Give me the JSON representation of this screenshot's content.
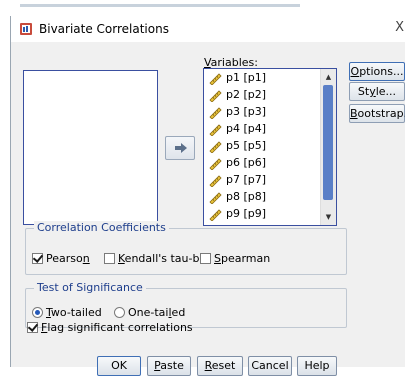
{
  "window": {
    "title": "Bivariate Correlations",
    "close_glyph": "X"
  },
  "variables": {
    "label": "Variables:",
    "items": [
      "p1 [p1]",
      "p2 [p2]",
      "p3 [p3]",
      "p4 [p4]",
      "p5 [p5]",
      "p6 [p6]",
      "p7 [p7]",
      "p8 [p8]",
      "p9 [p9]"
    ]
  },
  "side_buttons": {
    "options": "Options...",
    "style": "Style...",
    "bootstrap": "Bootstrap..."
  },
  "correlation_coefficients": {
    "title": "Correlation Coefficients",
    "pearson": {
      "label": "Pearson",
      "checked": true
    },
    "kendall": {
      "label": "Kendall's tau-b",
      "checked": false
    },
    "spearman": {
      "label": "Spearman",
      "checked": false
    }
  },
  "significance": {
    "title": "Test of Significance",
    "two_tailed": {
      "label": "Two-tailed",
      "selected": true
    },
    "one_tailed": {
      "label": "One-tailed",
      "selected": false
    }
  },
  "flag": {
    "label": "Flag significant correlations",
    "checked": true
  },
  "buttons": {
    "ok": "OK",
    "paste": "Paste",
    "reset": "Reset",
    "cancel": "Cancel",
    "help": "Help"
  },
  "colors": {
    "list_border": "#3a4fa0",
    "group_title": "#1e3e8c",
    "scroll_thumb": "#5a7fc7"
  },
  "icons": {
    "app": "spss-dialog-icon",
    "move": "arrow-right-icon",
    "variable": "scale-ruler-icon"
  }
}
